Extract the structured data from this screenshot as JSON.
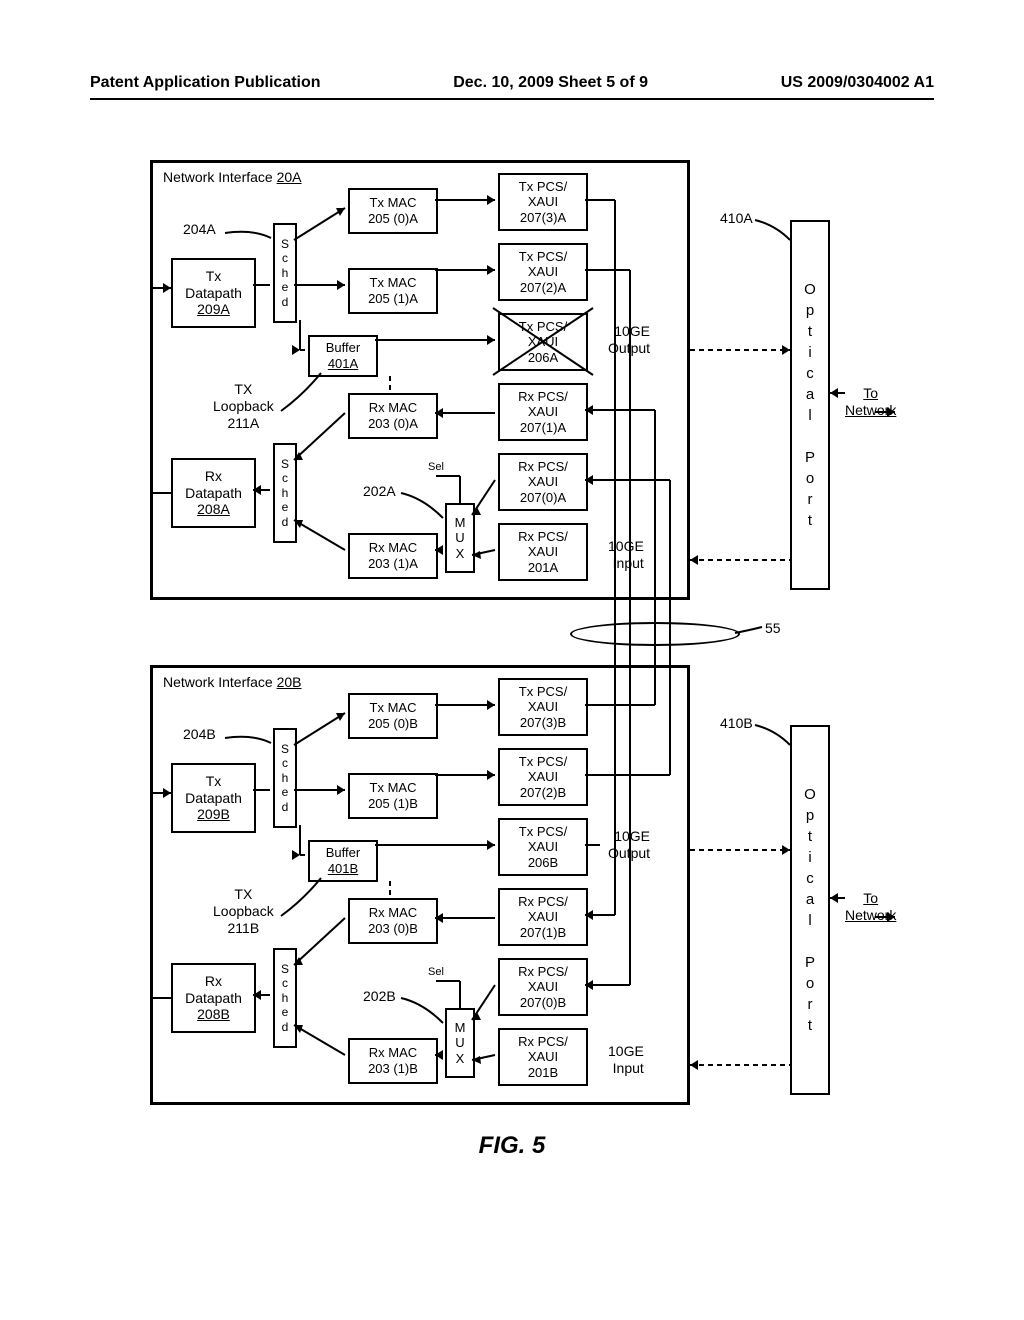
{
  "header": {
    "left": "Patent Application Publication",
    "center": "Dec. 10, 2009  Sheet 5 of 9",
    "right": "US 2009/0304002 A1"
  },
  "interface_a": {
    "title": "Network Interface",
    "title_ref": "20A",
    "tx_datapath": "Tx\nDatapath",
    "tx_datapath_ref": "209A",
    "rx_datapath": "Rx\nDatapath",
    "rx_datapath_ref": "208A",
    "sched_label_tx": "204A",
    "sched_vert": "S\nc\nh\ne\nd",
    "tx_mac_0": "Tx MAC\n205 (0)A",
    "tx_mac_1": "Tx MAC\n205 (1)A",
    "rx_mac_0": "Rx MAC\n203 (0)A",
    "rx_mac_1": "Rx MAC\n203 (1)A",
    "buffer": "Buffer",
    "buffer_ref": "401A",
    "tx_loopback": "TX\nLoopback\n211A",
    "sel": "Sel",
    "mux": "M\nU\nX",
    "mux_ref": "202A",
    "tx_pcs_3": "Tx PCS/\nXAUI\n207(3)A",
    "tx_pcs_2": "Tx PCS/\nXAUI\n207(2)A",
    "tx_pcs_crossed": "Tx PCS/\nXAUI\n206A",
    "rx_pcs_1": "Rx PCS/\nXAUI\n207(1)A",
    "rx_pcs_0": "Rx PCS/\nXAUI\n207(0)A",
    "rx_pcs_201": "Rx PCS/\nXAUI\n201A",
    "output_10ge": "10GE\nOutput",
    "input_10ge": "10GE\nInput",
    "optical_ref": "410A"
  },
  "interface_b": {
    "title": "Network Interface",
    "title_ref": "20B",
    "tx_datapath": "Tx\nDatapath",
    "tx_datapath_ref": "209B",
    "rx_datapath": "Rx\nDatapath",
    "rx_datapath_ref": "208B",
    "sched_label_tx": "204B",
    "sched_vert": "S\nc\nh\ne\nd",
    "tx_mac_0": "Tx MAC\n205 (0)B",
    "tx_mac_1": "Tx MAC\n205 (1)B",
    "rx_mac_0": "Rx MAC\n203 (0)B",
    "rx_mac_1": "Rx MAC\n203 (1)B",
    "buffer": "Buffer",
    "buffer_ref": "401B",
    "tx_loopback": "TX\nLoopback\n211B",
    "sel": "Sel",
    "mux": "M\nU\nX",
    "mux_ref": "202B",
    "tx_pcs_3": "Tx PCS/\nXAUI\n207(3)B",
    "tx_pcs_2": "Tx PCS/\nXAUI\n207(2)B",
    "tx_pcs_206": "Tx PCS/\nXAUI\n206B",
    "rx_pcs_1": "Rx PCS/\nXAUI\n207(1)B",
    "rx_pcs_0": "Rx PCS/\nXAUI\n207(0)B",
    "rx_pcs_201": "Rx PCS/\nXAUI\n201B",
    "output_10ge": "10GE\nOutput",
    "input_10ge": "10GE\nInput",
    "optical_ref": "410B"
  },
  "optical_port": "O\np\nt\ni\nc\na\nl\n\nP\no\nr\nt",
  "to_network": "To\nNetwork",
  "bus_label": "55",
  "figure": "FIG. 5"
}
